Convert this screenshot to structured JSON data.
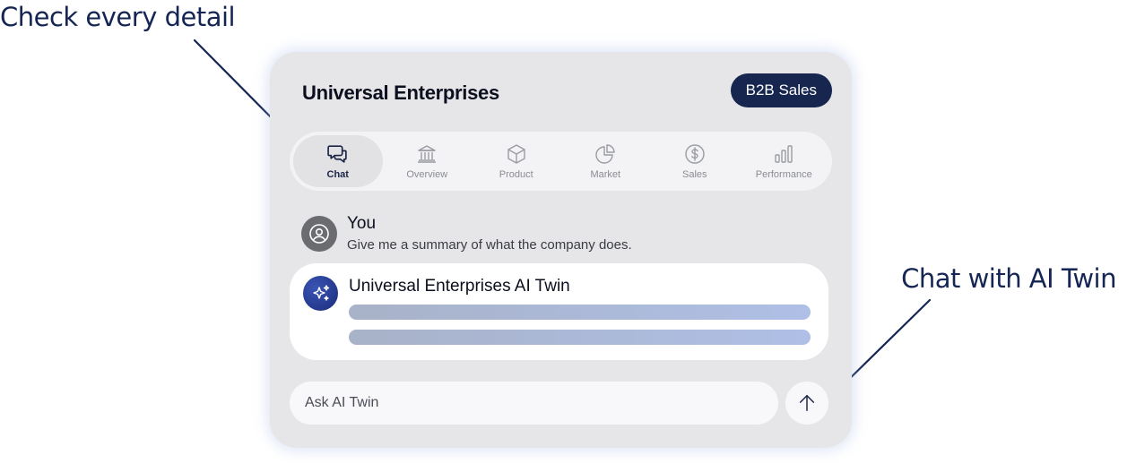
{
  "callouts": {
    "left": "Check every detail",
    "right": "Chat with AI Twin"
  },
  "header": {
    "company": "Universal Enterprises",
    "badge": "B2B Sales"
  },
  "tabs": [
    {
      "label": "Chat",
      "icon": "chat-icon",
      "active": true
    },
    {
      "label": "Overview",
      "icon": "bank-icon",
      "active": false
    },
    {
      "label": "Product",
      "icon": "box-icon",
      "active": false
    },
    {
      "label": "Market",
      "icon": "pie-chart-icon",
      "active": false
    },
    {
      "label": "Sales",
      "icon": "dollar-icon",
      "active": false
    },
    {
      "label": "Performance",
      "icon": "bar-chart-icon",
      "active": false
    }
  ],
  "chat": {
    "user_name": "You",
    "user_message": "Give me a summary of what the company does.",
    "ai_name": "Universal Enterprises AI Twin"
  },
  "input": {
    "placeholder": "Ask AI Twin"
  },
  "colors": {
    "navy": "#16264f",
    "card_bg": "#e6e6e8",
    "skeleton": "#afbfe6"
  }
}
